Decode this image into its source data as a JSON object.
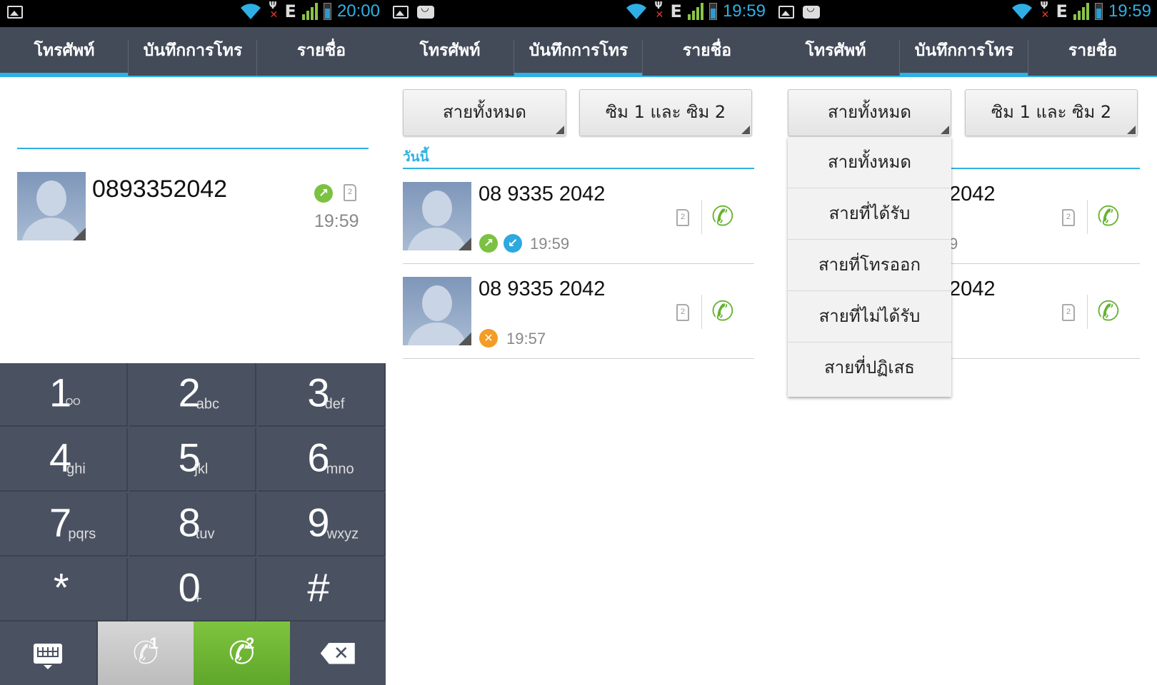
{
  "status": {
    "panel1_time": "20:00",
    "panel2_time": "19:59",
    "panel3_time": "19:59",
    "network": "E",
    "sim_indicator": "1",
    "accent_color": "#2db1e3"
  },
  "tabs": [
    "โทรศัพท์",
    "บันทึกการโทร",
    "รายชื่อ"
  ],
  "dialer": {
    "number": "0893352042",
    "last_call_time": "19:59",
    "sim_label": "2",
    "keys": [
      {
        "digit": "1",
        "letters": "ᴼᴼ"
      },
      {
        "digit": "2",
        "letters": "abc"
      },
      {
        "digit": "3",
        "letters": "def"
      },
      {
        "digit": "4",
        "letters": "ghi"
      },
      {
        "digit": "5",
        "letters": "jkl"
      },
      {
        "digit": "6",
        "letters": "mno"
      },
      {
        "digit": "7",
        "letters": "pqrs"
      },
      {
        "digit": "8",
        "letters": "tuv"
      },
      {
        "digit": "9",
        "letters": "wxyz"
      },
      {
        "digit": "*",
        "letters": ""
      },
      {
        "digit": "0",
        "letters": "+"
      },
      {
        "digit": "#",
        "letters": ""
      }
    ],
    "sim1_label": "1",
    "sim2_label": "2"
  },
  "calllog": {
    "filter_type": "สายทั้งหมด",
    "filter_sim": "ซิม 1 และ ซิม 2",
    "section": "วันนี้",
    "entries": [
      {
        "number": "08 9335 2042",
        "time": "19:59",
        "sim": "2"
      },
      {
        "number": "08 9335 2042",
        "time": "19:57",
        "sim": "2"
      }
    ],
    "partial_number": "2042",
    "partial_time": "9"
  },
  "dropdown": {
    "items": [
      "สายทั้งหมด",
      "สายที่ได้รับ",
      "สายที่โทรออก",
      "สายที่ไม่ได้รับ",
      "สายที่ปฏิเสธ"
    ]
  }
}
